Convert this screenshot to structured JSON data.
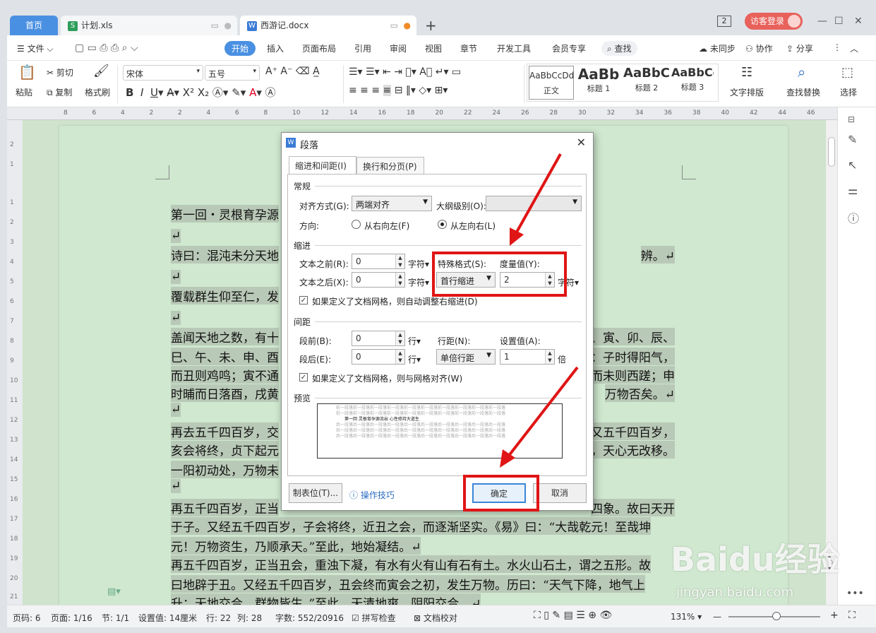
{
  "tabs": {
    "home": "首页",
    "tab1": "计划.xls",
    "tab2": "西游记.docx",
    "add": "+",
    "win_count": "2",
    "login": "访客登录"
  },
  "menu": {
    "file": "文件",
    "items": [
      "开始",
      "插入",
      "页面布局",
      "引用",
      "审阅",
      "视图",
      "章节",
      "开发工具",
      "会员专享"
    ],
    "search": "查找",
    "sync": "未同步",
    "collab": "协作",
    "share": "分享"
  },
  "ribbon": {
    "paste": "粘贴",
    "cut": "剪切",
    "copy": "复制",
    "format_painter": "格式刷",
    "font": "宋体",
    "size": "五号",
    "styles": [
      {
        "preview": "AaBbCcDd",
        "name": "正文"
      },
      {
        "preview": "AaBb",
        "name": "标题 1"
      },
      {
        "preview": "AaBbC",
        "name": "标题 2"
      },
      {
        "preview": "AaBbCc",
        "name": "标题 3"
      }
    ],
    "text_layout": "文字排版",
    "find_replace": "查找替换",
    "select": "选择"
  },
  "ruler_numbers": [
    "8",
    "6",
    "4",
    "2",
    "2",
    "4",
    "6",
    "8",
    "10",
    "12",
    "14",
    "16",
    "18",
    "20",
    "22",
    "24",
    "26",
    "28",
    "30",
    "32",
    "34",
    "36",
    "38",
    "40",
    "42",
    "44",
    "46"
  ],
  "vruler_numbers": [
    "2",
    "1",
    "1",
    "2",
    "3",
    "4",
    "5",
    "6",
    "7",
    "8",
    "9",
    "10",
    "11",
    "12",
    "13",
    "14",
    "15",
    "16",
    "17",
    "18",
    "19",
    "20",
    "21"
  ],
  "doc_lines": [
    {
      "text": "第一回・灵根育孕源",
      "hl": true
    },
    {
      "text": "↵",
      "hl": true
    },
    {
      "text": "诗曰：混沌未分天地",
      "hl": true
    },
    {
      "text": "↵",
      "hl": true
    },
    {
      "text": "覆载群生仰至仁，发",
      "hl": true
    },
    {
      "text": "↵",
      "hl": true
    },
    {
      "text": "盖闻天地之数，有十",
      "hl": true
    },
    {
      "text": "巳、午、未、申、酉",
      "hl": true
    },
    {
      "text": "而丑则鸡鸣；寅不通",
      "hl": true
    },
    {
      "text": "时晡而日落酉，戌黄",
      "hl": true
    },
    {
      "text": "↵",
      "hl": true
    },
    {
      "text": "再去五千四百岁，交",
      "hl": true
    },
    {
      "text": "亥会将终，贞下起元",
      "hl": true
    },
    {
      "text": "一阳初动处，万物未",
      "hl": true
    },
    {
      "text": "↵",
      "hl": true
    },
    {
      "text": "再五千四百岁，正当",
      "hl": true
    },
    {
      "text": "于子。又经五千四百岁，子会将终，近丑之会，而逐渐坚实。《易》曰：“大哉乾元！至哉坤",
      "hl": true
    },
    {
      "text": "元！万物资生，乃顺承天。”至此，地始凝结。↵",
      "hl": true
    },
    {
      "text": "再五千四百岁，正当丑会，重浊下凝，有水有火有山有石有土。水火山石土，谓之五形。故",
      "hl": true
    },
    {
      "text": "曰地辟于丑。又经五千四百岁，丑会终而寅会之初，发生万物。历曰：“天气下降，地气上",
      "hl": true
    },
    {
      "text": "升；天地交合，群物皆生。”至此，天清地爽，阴阳交合。↵",
      "hl": true
    }
  ],
  "doc_right_fragments": [
    {
      "text": "辨。↵",
      "line": 2
    },
    {
      "text": "丑、寅、卯、辰、",
      "line": 6
    },
    {
      "text": "论：子时得阳气，",
      "line": 7
    },
    {
      "text": "而未则西蹉；申",
      "line": 8
    },
    {
      "text": "万物否矣。↵",
      "line": 9
    },
    {
      "text": "又五千四百岁，",
      "line": 11
    },
    {
      "text": "，天心无改移。",
      "line": 12
    },
    {
      "text": "四象。故曰天开",
      "line": 15
    }
  ],
  "dialog": {
    "title": "段落",
    "tab_indent": "缩进和间距(I)",
    "tab_break": "换行和分页(P)",
    "sec_general": "常规",
    "align_label": "对齐方式(G):",
    "align_value": "两端对齐",
    "outline_label": "大纲级别(O):",
    "outline_value": "",
    "direction_label": "方向:",
    "rtl": "从右向左(F)",
    "ltr": "从左向右(L)",
    "sec_indent": "缩进",
    "before_text_label": "文本之前(R):",
    "before_text_value": "0",
    "after_text_label": "文本之后(X):",
    "after_text_value": "0",
    "unit_char": "字符▾",
    "special_label": "特殊格式(S):",
    "special_value": "首行缩进",
    "measure_label": "度量值(Y):",
    "measure_value": "2",
    "grid_indent_check": "如果定义了文档网格，则自动调整右缩进(D)",
    "sec_spacing": "间距",
    "before_label": "段前(B):",
    "before_value": "0",
    "after_label": "段后(E):",
    "after_value": "0",
    "unit_line": "行▾",
    "line_spacing_label": "行距(N):",
    "line_spacing_value": "单倍行距",
    "set_value_label": "设置值(A):",
    "set_value": "1",
    "unit_times": "倍",
    "grid_align_check": "如果定义了文档网格，则与网格对齐(W)",
    "sec_preview": "预览",
    "preview_prev": "前一段落前一段落前一段落前一段落前一段落前一段落前一段落前一段落前一段落前一段落",
    "preview_cur": "第一回 灵根育孕源流出 心性修持大道生",
    "preview_next": "后一段落后一段落后一段落后一段落后一段落后一段落后一段落后一段落后一段落后一段落",
    "tabs_button": "制表位(T)...",
    "tips": "操作技巧",
    "ok": "确定",
    "cancel": "取消"
  },
  "status": {
    "page_no": "页码: 6",
    "page": "页面: 1/16",
    "section": "节: 1/1",
    "setting": "设置值: 14厘米",
    "row": "行: 22",
    "col": "列: 28",
    "words": "字数: 552/20916",
    "spell": "拼写检查",
    "proof": "文档校对",
    "zoom": "131%"
  },
  "watermark": {
    "brand": "Baidu经验",
    "url": "jingyan.baidu.com"
  },
  "colors": {
    "accent": "#4a90e2",
    "highlight_red": "#e01515",
    "doc_bg": "#cfe8cf"
  }
}
